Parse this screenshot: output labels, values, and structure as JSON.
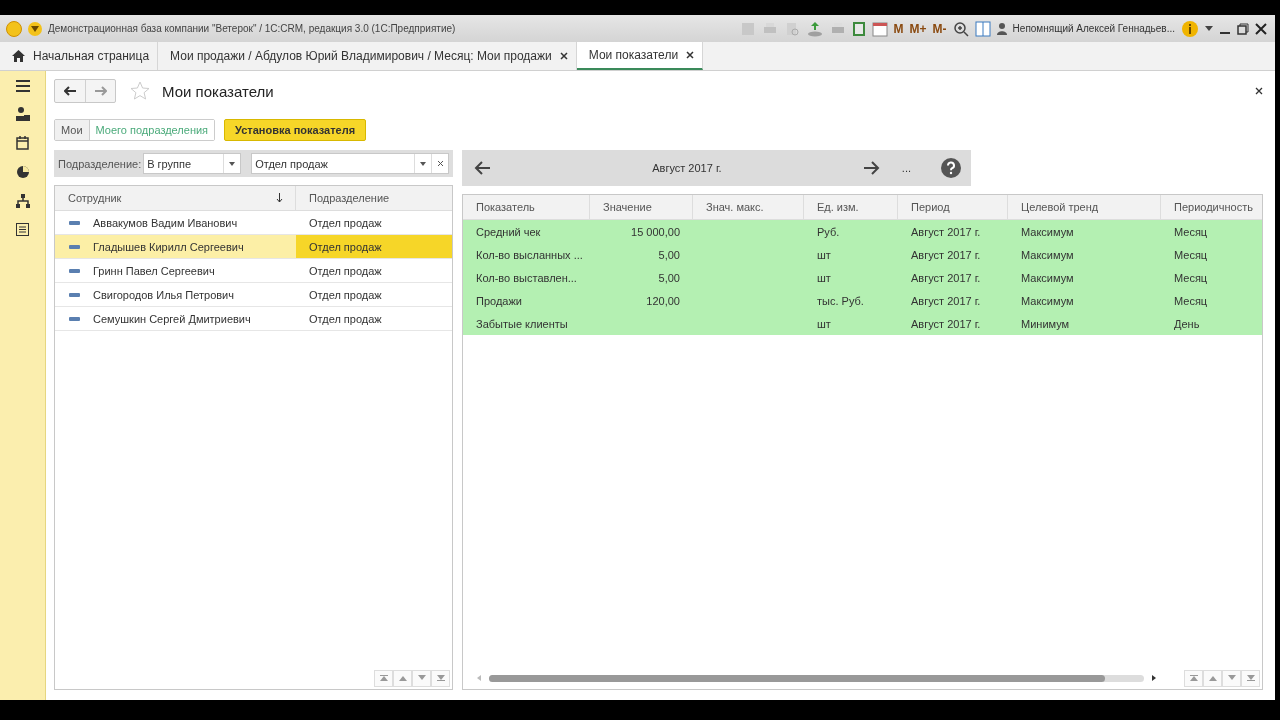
{
  "window": {
    "title": "Демонстрационная база компании \"Ветерок\" / 1С:CRM, редакция 3.0  (1С:Предприятие)",
    "memory_buttons": [
      "M",
      "M+",
      "M-"
    ],
    "user_name": "Непомнящий Алексей Геннадьев..."
  },
  "tabs": [
    {
      "label": "Начальная страница",
      "selected": false,
      "closable": false
    },
    {
      "label": "Мои продажи / Абдулов Юрий Владимирович / Месяц: Мои продажи",
      "selected": false,
      "closable": true
    },
    {
      "label": "Мои показатели",
      "selected": true,
      "closable": true
    }
  ],
  "page": {
    "title": "Мои показатели",
    "filter_buttons": [
      {
        "label": "Мои",
        "selected": false
      },
      {
        "label": "Моего подразделения",
        "selected": true
      }
    ],
    "action_button": "Установка показателя"
  },
  "filter": {
    "label": "Подразделение:",
    "condition": "В группе",
    "value": "Отдел продаж"
  },
  "employees": {
    "columns": [
      "Сотрудник",
      "Подразделение"
    ],
    "rows": [
      {
        "name": "Аввакумов Вадим Иванович",
        "department": "Отдел продаж",
        "selected": false
      },
      {
        "name": "Гладышев Кирилл Сергеевич",
        "department": "Отдел продаж",
        "selected": true
      },
      {
        "name": "Гринн Павел Сергеевич",
        "department": "Отдел продаж",
        "selected": false
      },
      {
        "name": "Свигородов Илья Петрович",
        "department": "Отдел продаж",
        "selected": false
      },
      {
        "name": "Семушкин Сергей Дмитриевич",
        "department": "Отдел продаж",
        "selected": false
      }
    ]
  },
  "period": {
    "label": "Август 2017 г.",
    "more": "..."
  },
  "indicators": {
    "columns": [
      "Показатель",
      "Значение",
      "Знач. макс.",
      "Ед. изм.",
      "Период",
      "Целевой тренд",
      "Периодичность"
    ],
    "rows": [
      {
        "cells": [
          "Средний чек",
          "15 000,00",
          "",
          "Руб.",
          "Август 2017 г.",
          "Максимум",
          "Месяц"
        ]
      },
      {
        "cells": [
          "Кол-во высланных ...",
          "5,00",
          "",
          "шт",
          "Август 2017 г.",
          "Максимум",
          "Месяц"
        ]
      },
      {
        "cells": [
          "Кол-во выставлен...",
          "5,00",
          "",
          "шт",
          "Август 2017 г.",
          "Максимум",
          "Месяц"
        ]
      },
      {
        "cells": [
          "Продажи",
          "120,00",
          "",
          "тыс. Руб.",
          "Август 2017 г.",
          "Максимум",
          "Месяц"
        ]
      },
      {
        "cells": [
          "Забытые клиенты",
          "",
          "",
          "шт",
          "Август 2017 г.",
          "Минимум",
          "День"
        ]
      }
    ]
  }
}
